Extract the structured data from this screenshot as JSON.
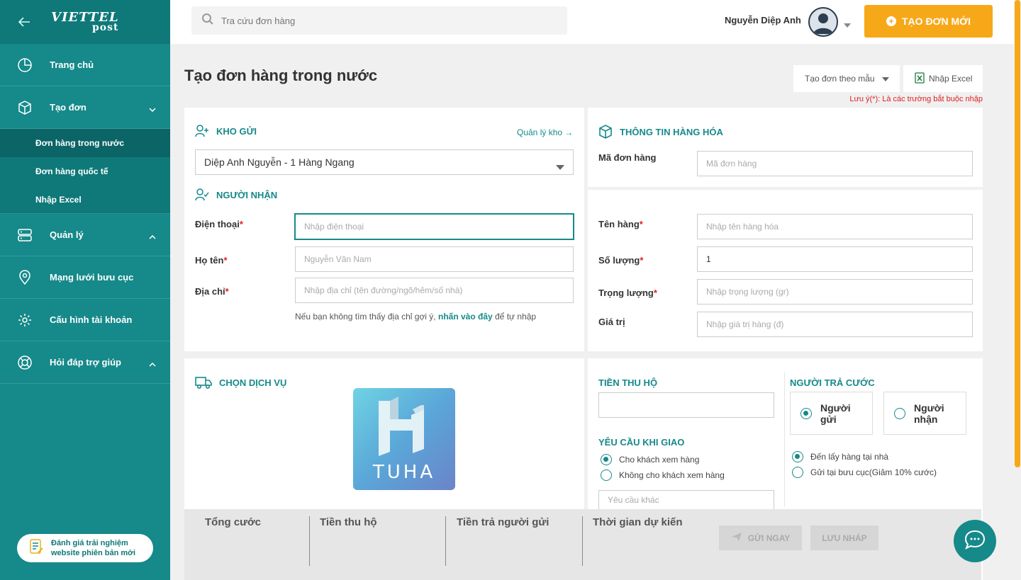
{
  "sidebar": {
    "logo_top": "VIETTEL",
    "logo_bottom": "post",
    "items": [
      {
        "label": "Trang chủ"
      },
      {
        "label": "Tạo đơn"
      },
      {
        "label": "Quản lý"
      },
      {
        "label": "Mạng lưới bưu cục"
      },
      {
        "label": "Cấu hình tài khoản"
      },
      {
        "label": "Hỏi đáp trợ giúp"
      }
    ],
    "subitems": [
      {
        "label": "Đơn hàng trong nước",
        "active": true
      },
      {
        "label": "Đơn hàng quốc tế"
      },
      {
        "label": "Nhập Excel"
      }
    ],
    "feedback_line1": "Đánh giá trải nghiệm",
    "feedback_line2": "website phiên bản mới"
  },
  "header": {
    "search_placeholder": "Tra cứu đơn hàng",
    "user_name": "Nguyễn Diệp Anh",
    "create_button": "TẠO ĐƠN MỚI"
  },
  "page": {
    "title": "Tạo đơn hàng trong nước",
    "template_button": "Tạo đơn theo mẫu",
    "excel_button": "Nhập Excel",
    "note": "Lưu ý(*): Là các trường bắt buộc nhập"
  },
  "sender": {
    "section_title": "KHO GỬI",
    "manage_link": "Quản lý kho →",
    "selected_warehouse": "Diệp Anh Nguyễn - 1 Hàng Ngang"
  },
  "receiver": {
    "section_title": "NGƯỜI NHẬN",
    "phone_label": "Điện thoại",
    "phone_placeholder": "Nhập điện thoại",
    "name_label": "Họ tên",
    "name_placeholder": "Nguyễn Văn Nam",
    "address_label": "Địa chỉ",
    "address_placeholder": "Nhập địa chỉ (tên đường/ngõ/hẻm/số nhà)",
    "hint_before": "Nếu bạn không tìm thấy địa chỉ gợi ý, ",
    "hint_link": "nhấn vào đây",
    "hint_after": " để tự nhập"
  },
  "goods": {
    "section_title": "THÔNG TIN HÀNG HÓA",
    "code_label": "Mã đơn hàng",
    "code_placeholder": "Mã đơn hàng",
    "name_label": "Tên hàng",
    "name_placeholder": "Nhập tên hàng hóa",
    "qty_label": "Số lượng",
    "qty_value": "1",
    "weight_label": "Trọng lượng",
    "weight_placeholder": "Nhập trọng lượng (gr)",
    "value_label": "Giá trị",
    "value_placeholder": "Nhập giá trị hàng (đ)",
    "required_mark": "*"
  },
  "service": {
    "section_title": "CHỌN DỊCH VỤ",
    "logo_text": "TUHA"
  },
  "cod": {
    "title": "TIỀN THU HỘ",
    "value": ""
  },
  "delivery": {
    "title": "YÊU CẦU KHI GIAO",
    "options": [
      "Cho khách xem hàng",
      "Không cho khách xem hàng"
    ],
    "other_placeholder": "Yêu cầu khác"
  },
  "payer": {
    "title": "NGƯỜI TRẢ CƯỚC",
    "sender_line1": "Người",
    "sender_line2": "gửi",
    "receiver_line1": "Người",
    "receiver_line2": "nhận",
    "pickup_options": [
      "Đến lấy hàng tại nhà",
      "Gửi tại bưu cục(Giảm 10% cước)"
    ]
  },
  "footer": {
    "total_label": "Tổng cước",
    "cod_label": "Tiền thu hộ",
    "sender_pay_label": "Tiền trả người gửi",
    "eta_label": "Thời gian dự kiến",
    "send_button": "GỬI NGAY",
    "draft_button": "LƯU NHÁP"
  },
  "colors": {
    "primary": "#16898a",
    "accent": "#f7a818",
    "required": "#e02020"
  }
}
